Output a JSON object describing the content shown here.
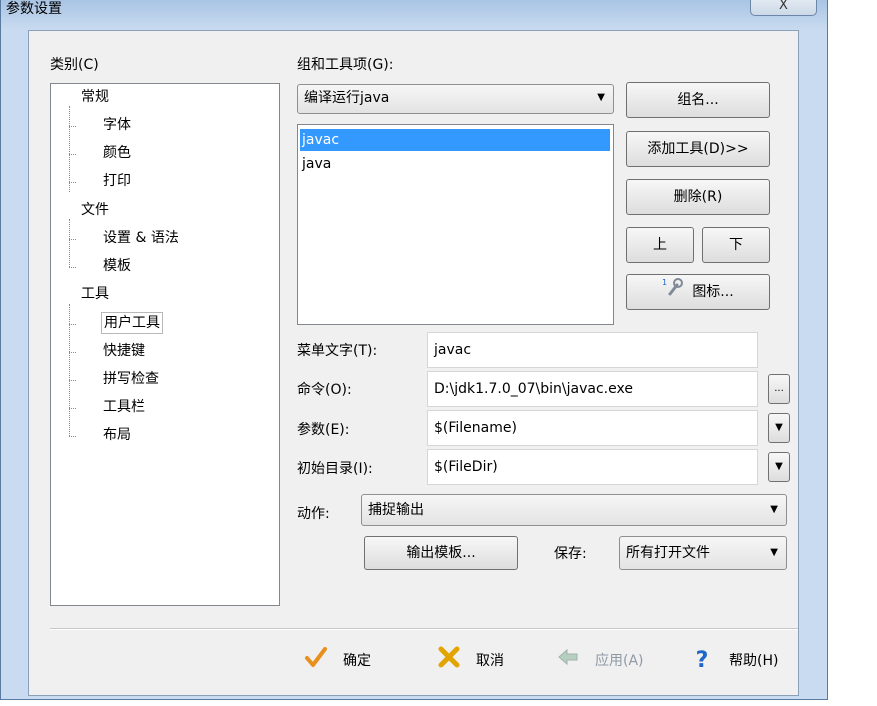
{
  "window": {
    "title": "参数设置",
    "close_label": "X"
  },
  "category": {
    "label": "类别(C)",
    "tree": {
      "general": "常规",
      "font": "字体",
      "color": "颜色",
      "print": "打印",
      "file": "文件",
      "settings_syntax": "设置 & 语法",
      "template": "模板",
      "tools": "工具",
      "user_tools": "用户工具",
      "shortcuts": "快捷键",
      "spellcheck": "拼写检查",
      "toolbar": "工具栏",
      "layout": "布局"
    }
  },
  "group": {
    "label": "组和工具项(G):",
    "selected": "编译运行java",
    "tools": [
      "javac",
      "java"
    ],
    "selected_tool": "javac"
  },
  "buttons": {
    "group_name": "组名...",
    "add_tool": "添加工具(D)>>",
    "delete": "删除(R)",
    "up": "上",
    "down": "下",
    "icon": "图标..."
  },
  "fields": {
    "menu_text_label": "菜单文字(T):",
    "menu_text_value": "javac",
    "command_label": "命令(O):",
    "command_value": "D:\\jdk1.7.0_07\\bin\\javac.exe",
    "command_browse": "...",
    "args_label": "参数(E):",
    "args_value": "$(Filename)",
    "initdir_label": "初始目录(I):",
    "initdir_value": "$(FileDir)"
  },
  "action": {
    "label": "动作:",
    "value": "捕捉输出",
    "output_template": "输出模板...",
    "save_label": "保存:",
    "save_value": "所有打开文件"
  },
  "footer": {
    "ok": "确定",
    "cancel": "取消",
    "apply": "应用(A)",
    "help": "帮助(H)"
  },
  "colors": {
    "selection": "#3399ff",
    "ok_icon": "#e8901c",
    "cancel_icon": "#e2a400",
    "help_icon": "#1f66c9"
  }
}
